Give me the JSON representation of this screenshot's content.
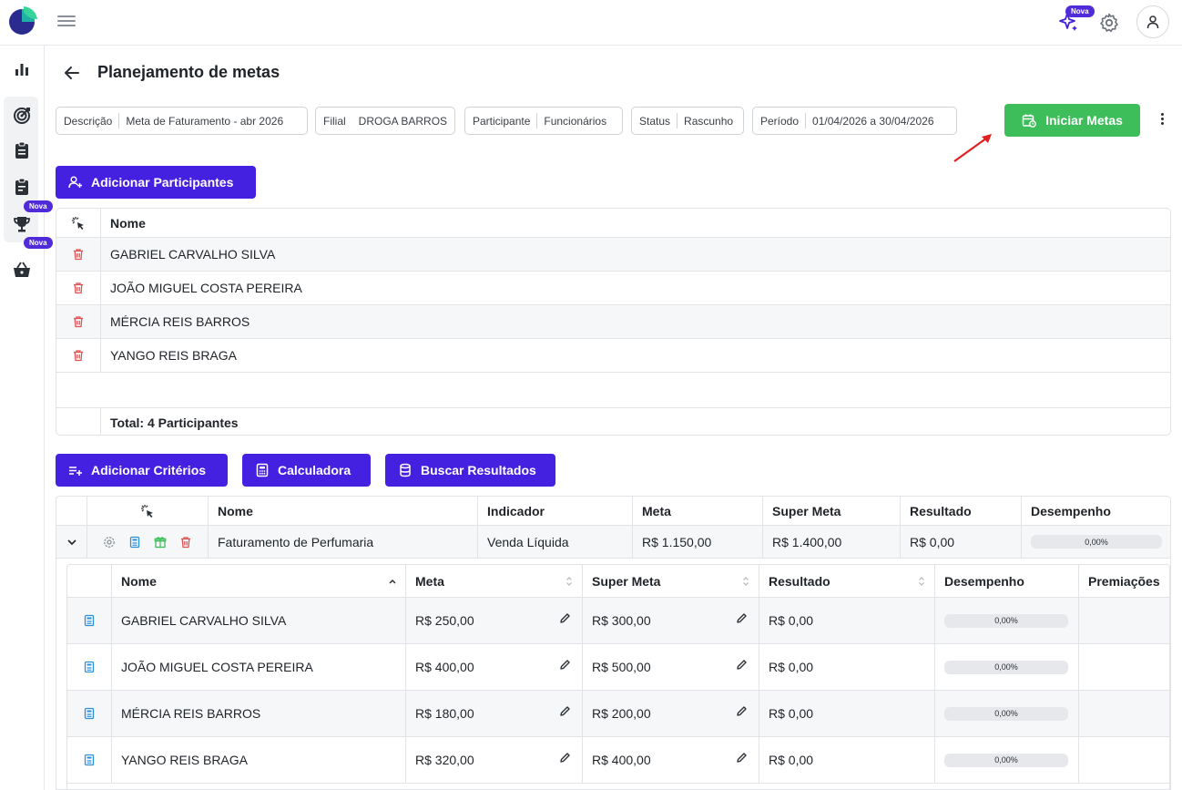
{
  "header": {
    "nova_badge": "Nova"
  },
  "sidebar": {
    "badges": [
      "Nova",
      "Nova"
    ]
  },
  "page": {
    "title": "Planejamento de metas"
  },
  "filters": [
    {
      "label": "Descrição",
      "value": "Meta de Faturamento - abr 2026"
    },
    {
      "label": "Filial",
      "value": "DROGA BARROS"
    },
    {
      "label": "Participante",
      "value": "Funcionários"
    },
    {
      "label": "Status",
      "value": "Rascunho"
    },
    {
      "label": "Período",
      "value": "01/04/2026 a 30/04/2026"
    }
  ],
  "actions": {
    "start_goals": "Iniciar Metas",
    "add_participants": "Adicionar Participantes",
    "add_criteria": "Adicionar Critérios",
    "calculator": "Calculadora",
    "fetch_results": "Buscar Resultados"
  },
  "participants_table": {
    "header_name": "Nome",
    "rows": [
      "GABRIEL CARVALHO SILVA",
      "JOÃO MIGUEL COSTA PEREIRA",
      "MÉRCIA REIS BARROS",
      "YANGO REIS BRAGA"
    ],
    "total": "Total: 4 Participantes"
  },
  "criteria_table": {
    "headers": {
      "name": "Nome",
      "indicator": "Indicador",
      "goal": "Meta",
      "super_goal": "Super Meta",
      "result": "Resultado",
      "performance": "Desempenho"
    },
    "row": {
      "name": "Faturamento de Perfumaria",
      "indicator": "Venda Líquida",
      "goal": "R$ 1.150,00",
      "super_goal": "R$ 1.400,00",
      "result": "R$ 0,00",
      "performance": "0,00%"
    }
  },
  "detail_table": {
    "headers": {
      "name": "Nome",
      "goal": "Meta",
      "super_goal": "Super Meta",
      "result": "Resultado",
      "performance": "Desempenho",
      "awards": "Premiações"
    },
    "rows": [
      {
        "name": "GABRIEL CARVALHO SILVA",
        "goal": "R$ 250,00",
        "super_goal": "R$ 300,00",
        "result": "R$ 0,00",
        "performance": "0,00%"
      },
      {
        "name": "JOÃO MIGUEL COSTA PEREIRA",
        "goal": "R$ 400,00",
        "super_goal": "R$ 500,00",
        "result": "R$ 0,00",
        "performance": "0,00%"
      },
      {
        "name": "MÉRCIA REIS BARROS",
        "goal": "R$ 180,00",
        "super_goal": "R$ 200,00",
        "result": "R$ 0,00",
        "performance": "0,00%"
      },
      {
        "name": "YANGO REIS BRAGA",
        "goal": "R$ 320,00",
        "super_goal": "R$ 400,00",
        "result": "R$ 0,00",
        "performance": "0,00%"
      }
    ]
  },
  "colors": {
    "primary": "#4420e0",
    "success": "#3dbe5a",
    "danger": "#e05252",
    "info": "#2d8fd6"
  }
}
